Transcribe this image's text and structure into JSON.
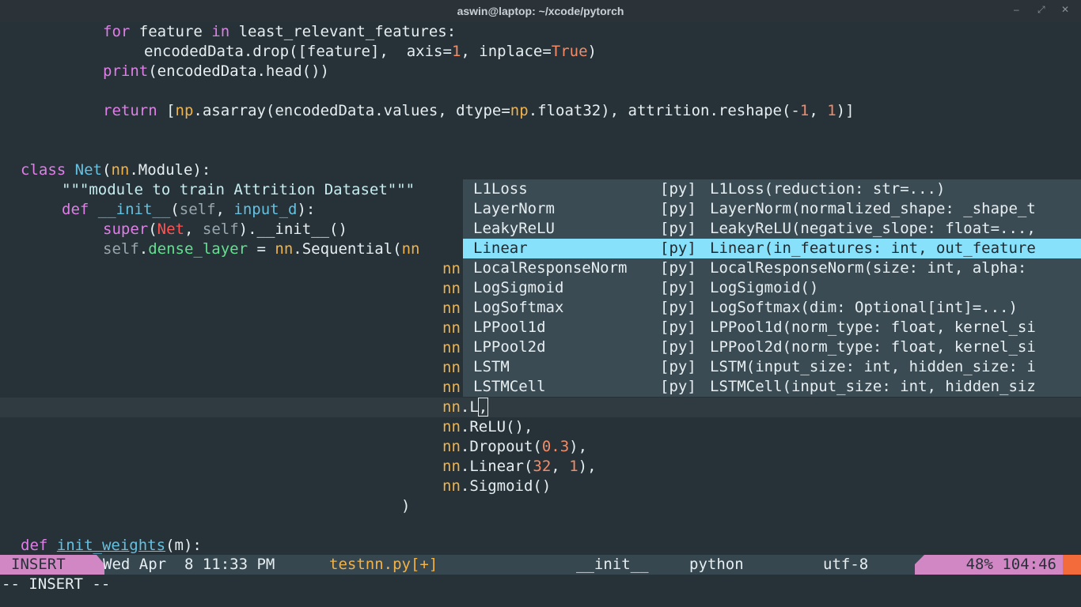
{
  "window": {
    "title": "aswin@laptop: ~/xcode/pytorch",
    "minimize": "–",
    "restore": "⤢",
    "close": "✕"
  },
  "code": {
    "l1": [
      "for",
      " feature ",
      "in",
      " least_relevant_features:"
    ],
    "l2": [
      "encodedData.drop([feature],  axis=",
      "1",
      ", inplace=",
      "True",
      ")"
    ],
    "l3": [
      "print",
      "(encodedData.head())"
    ],
    "l5": [
      "return",
      " [",
      "np",
      ".asarray(encodedData.values, dtype=",
      "np",
      ".float32), attrition.reshape(-",
      "1",
      ", ",
      "1",
      ")]"
    ],
    "l8": [
      "class",
      " ",
      "Net",
      "(",
      "nn",
      ".Module):"
    ],
    "l9": [
      "\"\"\"module to train Attrition Dataset\"\"\""
    ],
    "l10": [
      "def",
      " ",
      "__init__",
      "(",
      "self",
      ", ",
      "input_d",
      "):"
    ],
    "l11": [
      "super",
      "(",
      "Net",
      ", ",
      "self",
      ").__init__()"
    ],
    "l12": [
      "self",
      ".",
      "dense_layer",
      " = ",
      "nn",
      ".Sequential(",
      "nn"
    ],
    "nn": "nn",
    "l20a": "nn",
    "l20b": ".L",
    "l20c": ",",
    "l21": [
      "nn",
      ".ReLU(),"
    ],
    "l22": [
      "nn",
      ".Dropout(",
      "0.3",
      "),"
    ],
    "l23": [
      "nn",
      ".Linear(",
      "32",
      ", ",
      "1",
      "),"
    ],
    "l24": [
      "nn",
      ".Sigmoid()"
    ],
    "l25": ")",
    "l27": [
      "def",
      " ",
      "init_weights",
      "(m):"
    ]
  },
  "completion": {
    "items": [
      {
        "name": "L1Loss",
        "kind": "[py]",
        "sig": "L1Loss(reduction: str=...)"
      },
      {
        "name": "LayerNorm",
        "kind": "[py]",
        "sig": "LayerNorm(normalized_shape: _shape_t"
      },
      {
        "name": "LeakyReLU",
        "kind": "[py]",
        "sig": "LeakyReLU(negative_slope: float=...,"
      },
      {
        "name": "Linear",
        "kind": "[py]",
        "sig": "Linear(in_features: int, out_feature"
      },
      {
        "name": "LocalResponseNorm",
        "kind": "[py]",
        "sig": "LocalResponseNorm(size: int, alpha:"
      },
      {
        "name": "LogSigmoid",
        "kind": "[py]",
        "sig": "LogSigmoid()"
      },
      {
        "name": "LogSoftmax",
        "kind": "[py]",
        "sig": "LogSoftmax(dim: Optional[int]=...)"
      },
      {
        "name": "LPPool1d",
        "kind": "[py]",
        "sig": "LPPool1d(norm_type: float, kernel_si"
      },
      {
        "name": "LPPool2d",
        "kind": "[py]",
        "sig": "LPPool2d(norm_type: float, kernel_si"
      },
      {
        "name": "LSTM",
        "kind": "[py]",
        "sig": "LSTM(input_size: int, hidden_size: i"
      },
      {
        "name": "LSTMCell",
        "kind": "[py]",
        "sig": "LSTMCell(input_size: int, hidden_siz"
      }
    ]
  },
  "statusline": {
    "mode": "INSERT",
    "clock": "Wed Apr  8 11:33 PM",
    "file": "testnn.py[+]",
    "func": "__init__",
    "lang": "python",
    "encoding": "utf-8",
    "position": "48% 104:46"
  },
  "cmdline": "-- INSERT --"
}
